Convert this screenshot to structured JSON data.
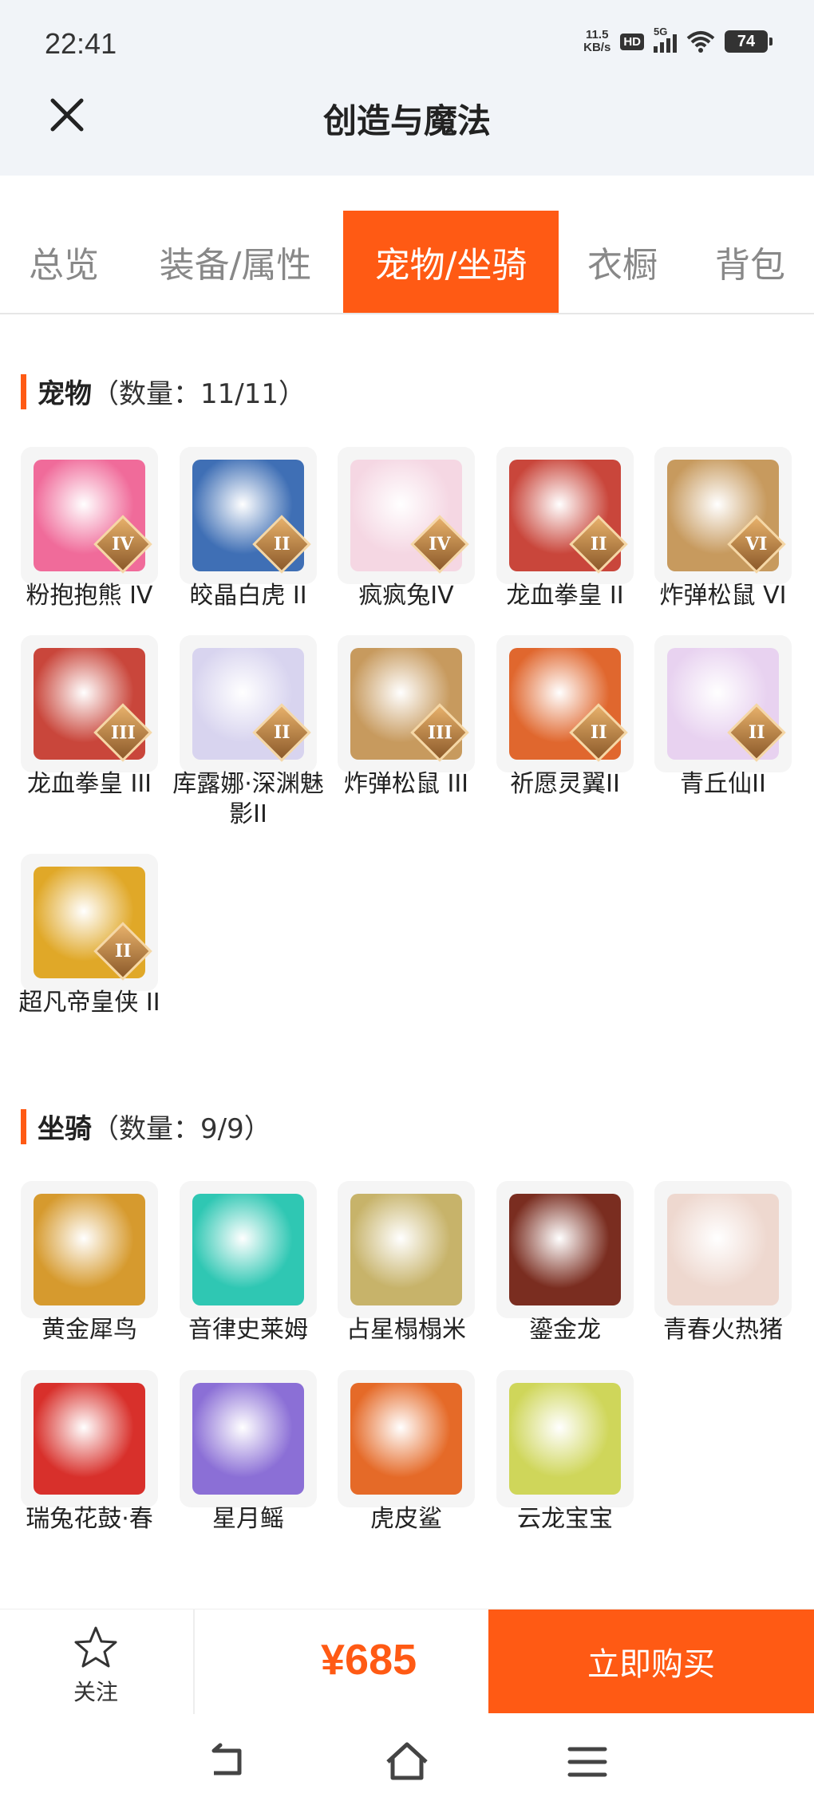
{
  "status_bar": {
    "time": "22:41",
    "net_speed_value": "11.5",
    "net_speed_unit": "KB/s",
    "hd": "HD",
    "network": "5G",
    "battery": "74"
  },
  "header": {
    "title": "创造与魔法"
  },
  "tabs": [
    {
      "label": "总览",
      "active": false
    },
    {
      "label": "装备/属性",
      "active": false
    },
    {
      "label": "宠物/坐骑",
      "active": true
    },
    {
      "label": "衣橱",
      "active": false
    },
    {
      "label": "背包",
      "active": false
    }
  ],
  "pets": {
    "title": "宠物",
    "count": "（数量：11/11）",
    "items": [
      {
        "name": "粉抱抱熊 IV",
        "rank": "IV",
        "icon": "pink-bear-icon",
        "color": "#f06b9a"
      },
      {
        "name": "皎晶白虎 II",
        "rank": "II",
        "icon": "white-tiger-icon",
        "color": "#3f6fb5"
      },
      {
        "name": "疯疯兔IV",
        "rank": "IV",
        "icon": "rabbit-icon",
        "color": "#f5d7e3"
      },
      {
        "name": "龙血拳皇 II",
        "rank": "II",
        "icon": "dragon-boxer-icon",
        "color": "#c9463b"
      },
      {
        "name": "炸弹松鼠 VI",
        "rank": "VI",
        "icon": "bomb-squirrel-icon",
        "color": "#c79a5e"
      },
      {
        "name": "龙血拳皇 III",
        "rank": "III",
        "icon": "dragon-boxer-icon",
        "color": "#c9463b"
      },
      {
        "name": "库露娜·深渊魅影II",
        "rank": "II",
        "icon": "kuluna-icon",
        "color": "#d8d4ef"
      },
      {
        "name": "炸弹松鼠 III",
        "rank": "III",
        "icon": "bomb-squirrel-icon",
        "color": "#c79a5e"
      },
      {
        "name": "祈愿灵翼II",
        "rank": "II",
        "icon": "spirit-wing-icon",
        "color": "#e0672e"
      },
      {
        "name": "青丘仙II",
        "rank": "II",
        "icon": "fox-fairy-icon",
        "color": "#e8d2f0"
      },
      {
        "name": "超凡帝皇侠 II",
        "rank": "II",
        "icon": "emperor-hero-icon",
        "color": "#e0a828"
      }
    ]
  },
  "mounts": {
    "title": "坐骑",
    "count": "（数量：9/9）",
    "items": [
      {
        "name": "黄金犀鸟",
        "icon": "hornbill-icon",
        "color": "#d69a2e"
      },
      {
        "name": "音律史莱姆",
        "icon": "slime-icon",
        "color": "#2fc7b3"
      },
      {
        "name": "占星榻榻米",
        "icon": "tatami-icon",
        "color": "#c7b36a"
      },
      {
        "name": "鎏金龙",
        "icon": "gold-dragon-icon",
        "color": "#7a2d20"
      },
      {
        "name": "青春火热猪",
        "icon": "pig-icon",
        "color": "#eed8cf"
      },
      {
        "name": "瑞兔花鼓·春",
        "icon": "drum-icon",
        "color": "#d8302b"
      },
      {
        "name": "星月鳐",
        "icon": "ray-fish-icon",
        "color": "#8b6fd6"
      },
      {
        "name": "虎皮鲨",
        "icon": "shark-icon",
        "color": "#e56a28"
      },
      {
        "name": "云龙宝宝",
        "icon": "cloud-dragon-icon",
        "color": "#cfd65a"
      }
    ]
  },
  "bottom_bar": {
    "follow_label": "关注",
    "price": "¥685",
    "buy_label": "立即购买"
  },
  "colors": {
    "accent": "#ff5a14",
    "header_bg": "#f1f4f8"
  }
}
